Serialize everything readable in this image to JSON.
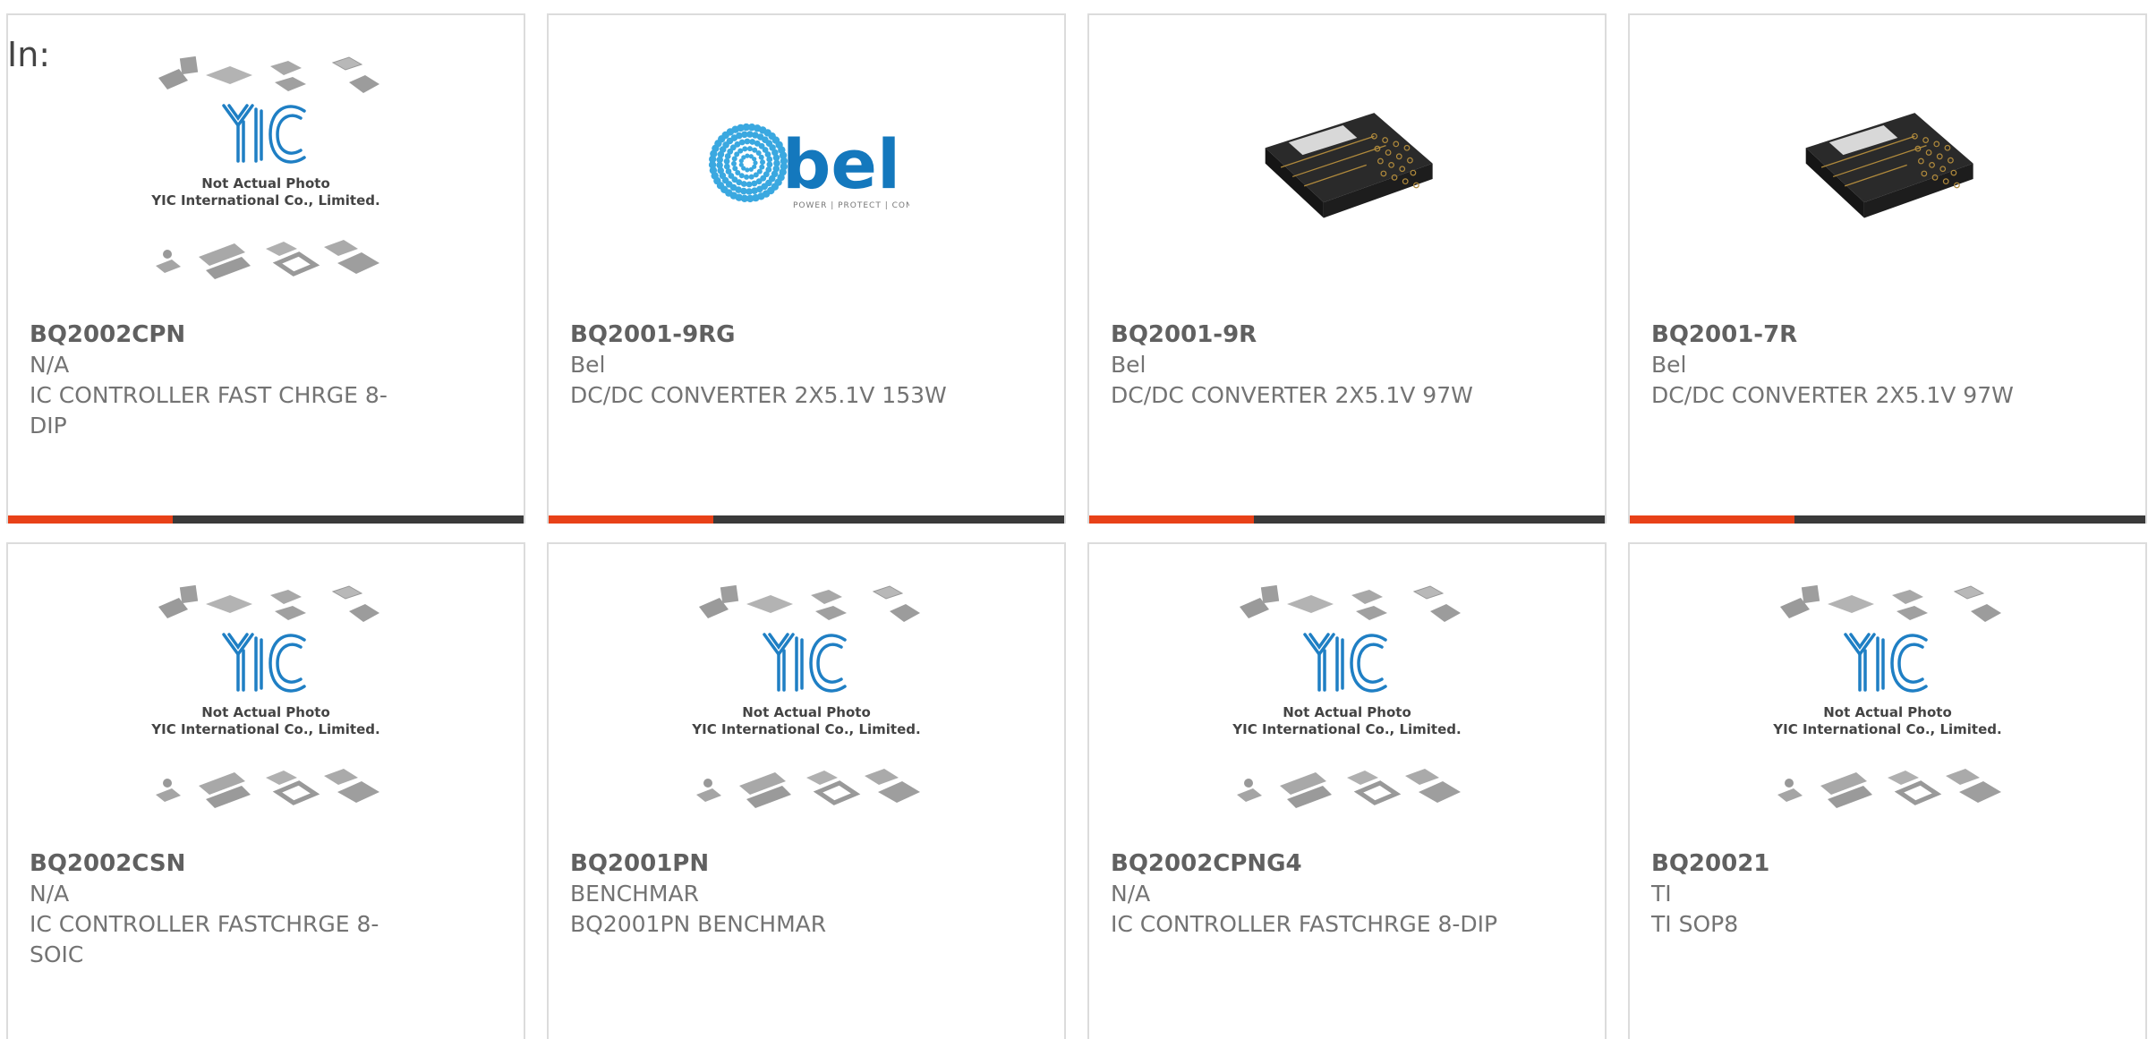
{
  "header": {
    "in_label": "In:"
  },
  "placeholder": {
    "line1": "Not Actual Photo",
    "line2": "YIC International Co., Limited.",
    "logo": "YIC"
  },
  "bel_logo": {
    "name": "bel",
    "tagline": "POWER | PROTECT | CONNECT"
  },
  "colors": {
    "accent": "#e84118",
    "bar": "#3a3a3a",
    "yic_blue": "#1f7fc4",
    "bel_blue": "#1478bd"
  },
  "products": [
    {
      "part": "BQ2002CPN",
      "mfr": "N/A",
      "desc": "IC CONTROLLER FAST CHRGE 8-DIP",
      "image": "placeholder"
    },
    {
      "part": "BQ2001-9RG",
      "mfr": "Bel",
      "desc": "DC/DC CONVERTER 2X5.1V 153W",
      "image": "bel-logo"
    },
    {
      "part": "BQ2001-9R",
      "mfr": "Bel",
      "desc": "DC/DC CONVERTER 2X5.1V 97W",
      "image": "converter-module"
    },
    {
      "part": "BQ2001-7R",
      "mfr": "Bel",
      "desc": "DC/DC CONVERTER 2X5.1V 97W",
      "image": "converter-module"
    },
    {
      "part": "BQ2002CSN",
      "mfr": "N/A",
      "desc": "IC CONTROLLER FASTCHRGE 8-SOIC",
      "image": "placeholder"
    },
    {
      "part": "BQ2001PN",
      "mfr": "BENCHMAR",
      "desc": "BQ2001PN BENCHMAR",
      "image": "placeholder"
    },
    {
      "part": "BQ2002CPNG4",
      "mfr": "N/A",
      "desc": "IC CONTROLLER FASTCHRGE 8-DIP",
      "image": "placeholder"
    },
    {
      "part": "BQ20021",
      "mfr": "TI",
      "desc": "TI SOP8",
      "image": "placeholder"
    }
  ]
}
